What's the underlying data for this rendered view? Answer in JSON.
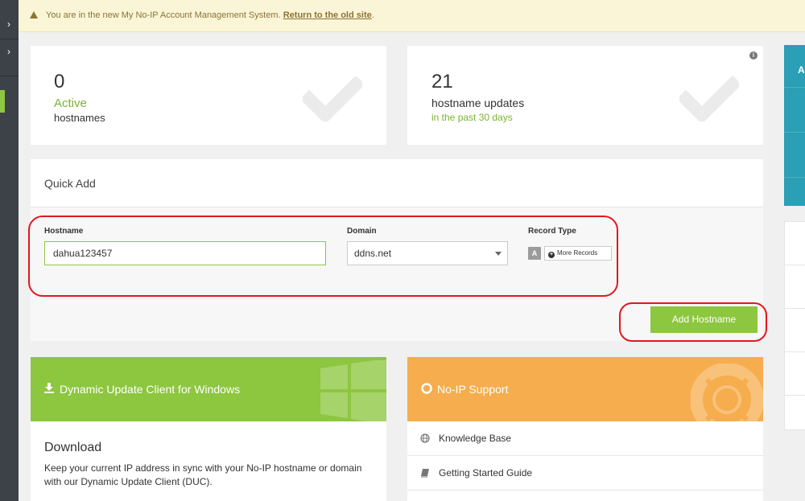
{
  "notice": {
    "text": "You are in the new My No-IP Account Management System. ",
    "link": "Return to the old site",
    "suffix": ".",
    "icon": "warning-icon"
  },
  "stats": {
    "active": {
      "count": "0",
      "label_green": "Active",
      "label": "hostnames",
      "icon": "checkmark-icon"
    },
    "updates": {
      "count": "21",
      "label": "hostname updates",
      "sub": "in the past 30 days",
      "icon": "checkmark-icon",
      "info_icon": "i"
    }
  },
  "quick_add": {
    "title": "Quick Add",
    "hostname_label": "Hostname",
    "hostname_value": "dahua123457",
    "domain_label": "Domain",
    "domain_value": "ddns.net",
    "record_type_label": "Record Type",
    "record_type_value": "A",
    "more_records_label": "More Records",
    "add_button_label": "Add Hostname"
  },
  "duc": {
    "title": "Dynamic Update Client for Windows",
    "heading": "Download",
    "text": "Keep your current IP address in sync with your No-IP hostname or domain with our Dynamic Update Client (DUC)."
  },
  "support": {
    "title": "No-IP Support",
    "items": [
      {
        "label": "Knowledge Base",
        "icon": "globe-icon"
      },
      {
        "label": "Getting Started Guide",
        "icon": "book-icon"
      }
    ]
  },
  "right_panel": {
    "label": "A"
  },
  "colors": {
    "green": "#8dc63f",
    "orange": "#f5ad4e",
    "teal": "#2a9fb5",
    "annotation_red": "#e3161f"
  }
}
